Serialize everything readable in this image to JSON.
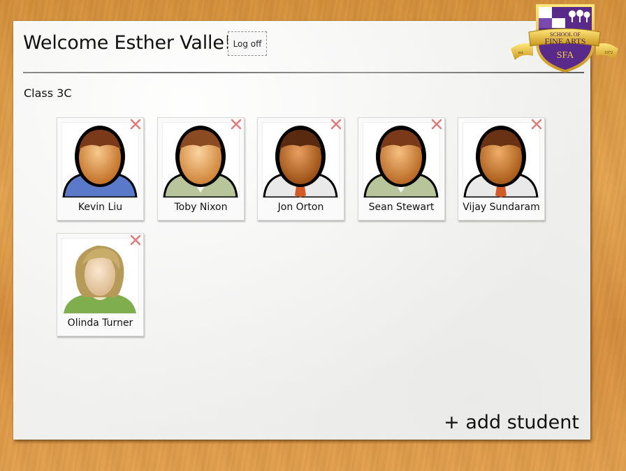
{
  "header": {
    "welcome": "Welcome Esther Valle!",
    "logoff_label": "Log off"
  },
  "class_name": "Class 3C",
  "students": [
    {
      "name": "Kevin Liu",
      "avatar": "male-avatar-blue-sweater-icon"
    },
    {
      "name": "Toby Nixon",
      "avatar": "male-avatar-green-jacket-icon"
    },
    {
      "name": "Jon Orton",
      "avatar": "male-avatar-white-shirt-tie-icon"
    },
    {
      "name": "Sean Stewart",
      "avatar": "male-avatar-green-jacket-icon"
    },
    {
      "name": "Vijay Sundaram",
      "avatar": "male-avatar-white-shirt-tie-icon"
    },
    {
      "name": "Olinda Turner",
      "avatar": "female-avatar-icon"
    }
  ],
  "add_student_label": "+ add student",
  "logo": {
    "line1": "SCHOOL OF",
    "line2": "FINE ARTS",
    "initials": "SFA",
    "est_left": "est",
    "est_right": "1972"
  },
  "colors": {
    "logo_purple": "#5a2a8a",
    "logo_gold": "#e8c53a",
    "remove_x": "#e07a7a"
  }
}
